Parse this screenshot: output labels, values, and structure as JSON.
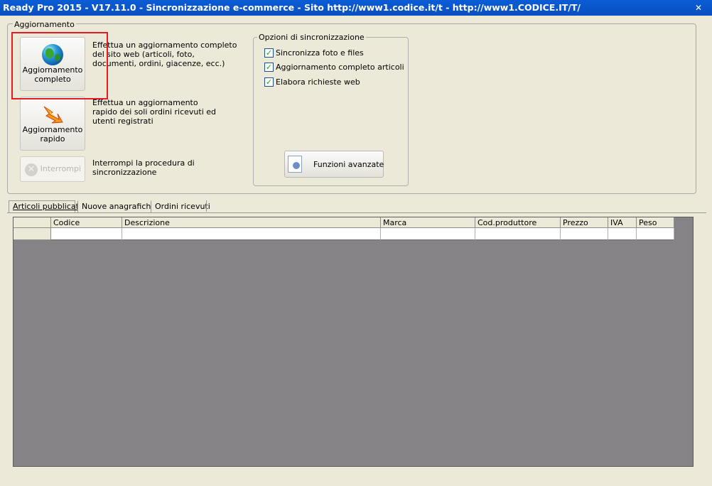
{
  "window": {
    "title": "Ready Pro 2015 - V17.11.0 - Sincronizzazione e-commerce - Sito http://www1.codice.it/t - http://www1.CODICE.IT/T/",
    "close_label": "✕"
  },
  "update_group": {
    "legend": "Aggiornamento",
    "full_update": {
      "label_line1": "Aggiornamento",
      "label_line2": "completo",
      "desc_line1": "Effettua un aggiornamento completo",
      "desc_line2": "del sito web (articoli, foto,",
      "desc_line3": "documenti, ordini, giacenze, ecc.)"
    },
    "quick_update": {
      "label_line1": "Aggiornamento",
      "label_line2": "rapido",
      "desc_line1": "Effettua un aggiornamento",
      "desc_line2": "rapido dei soli ordini ricevuti ed",
      "desc_line3": "utenti registrati"
    },
    "stop": {
      "label": "Interrompi",
      "desc_line1": "Interrompi la procedura di",
      "desc_line2": "sincronizzazione"
    }
  },
  "sync_options": {
    "legend": "Opzioni di sincronizzazione",
    "options": [
      {
        "label": "Sincronizza foto e files",
        "checked": true
      },
      {
        "label": "Aggiornamento completo articoli",
        "checked": true
      },
      {
        "label": "Elabora richieste web",
        "checked": true
      }
    ],
    "advanced_button": "Funzioni avanzate"
  },
  "tabs": [
    {
      "label": "Articoli pubblicati",
      "active": true
    },
    {
      "label": "Nuove anagrafiche",
      "active": false
    },
    {
      "label": "Ordini ricevuti",
      "active": false
    }
  ],
  "grid": {
    "columns": [
      "Codice",
      "Descrizione",
      "Marca",
      "Cod.produttore",
      "Prezzo",
      "IVA",
      "Peso"
    ]
  },
  "colors": {
    "highlight": "#e31b23",
    "titlebar": "#0a5cd6",
    "grid_background": "#858385"
  }
}
